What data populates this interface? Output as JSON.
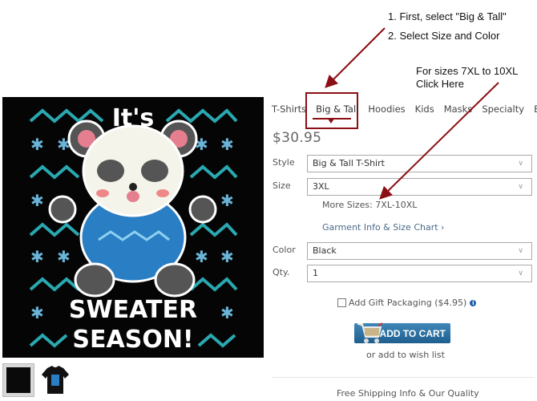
{
  "annotations": {
    "step1": "1. First, select \"Big & Tall\"",
    "step2": "2. Select Size and Color",
    "sizes_note_line1": "For sizes 7XL to 10XL",
    "sizes_note_line2": "Click Here",
    "arrow_color": "#8b0f14"
  },
  "product": {
    "image_alt": "It's Sweater Season! panda in blue sweater",
    "image_text_top": "It's",
    "image_text_mid": "SWEATER",
    "image_text_bottom": "SEASON!",
    "thumbnails": [
      "design-thumbnail",
      "black-tshirt-thumbnail"
    ]
  },
  "tabs": [
    {
      "label": "T-Shirts",
      "active": false
    },
    {
      "label": "Big & Tall",
      "active": true
    },
    {
      "label": "Hoodies",
      "active": false
    },
    {
      "label": "Kids",
      "active": false
    },
    {
      "label": "Masks",
      "active": false
    },
    {
      "label": "Specialty",
      "active": false
    },
    {
      "label": "Bags",
      "active": false
    }
  ],
  "price": "$30.95",
  "fields": {
    "style": {
      "label": "Style",
      "value": "Big & Tall T-Shirt"
    },
    "size": {
      "label": "Size",
      "value": "3XL"
    },
    "color": {
      "label": "Color",
      "value": "Black"
    },
    "qty": {
      "label": "Qty.",
      "value": "1"
    }
  },
  "more_sizes": "More Sizes: 7XL-10XL",
  "garment_link": "Garment Info & Size Chart ›",
  "gift": {
    "label": "Add Gift Packaging ($4.95)",
    "checked": false,
    "info_icon": "i"
  },
  "add_to_cart": "ADD TO CART",
  "wishlist": "or add to wish list",
  "shipping": "Free Shipping Info & Our Quality",
  "colors": {
    "accent": "#8b0f14",
    "cart_button": "#2a6f9f",
    "link": "#4a6a8a"
  }
}
